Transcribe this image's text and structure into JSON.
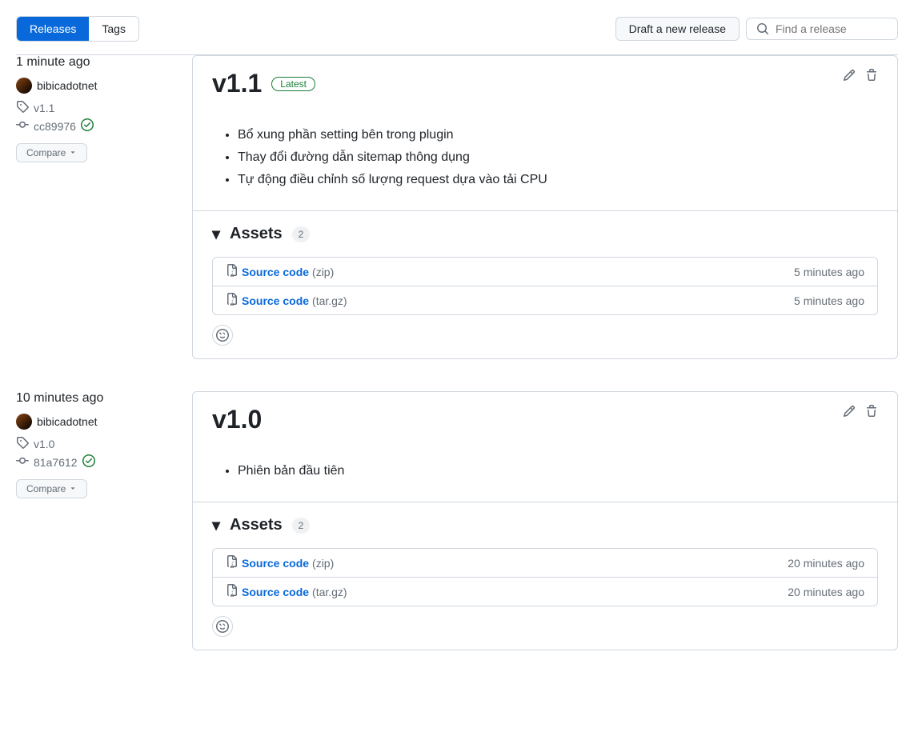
{
  "header": {
    "tabs": {
      "releases": "Releases",
      "tags": "Tags"
    },
    "draft_button": "Draft a new release",
    "search_placeholder": "Find a release"
  },
  "releases": [
    {
      "time": "1 minute ago",
      "author": "bibicadotnet",
      "tag": "v1.1",
      "commit": "cc89976",
      "compare": "Compare",
      "title": "v1.1",
      "latest_label": "Latest",
      "latest": true,
      "notes": [
        "Bổ xung phần setting bên trong plugin",
        "Thay đổi đường dẫn sitemap thông dụng",
        "Tự động điều chỉnh số lượng request dựa vào tải CPU"
      ],
      "assets_label": "Assets",
      "assets_count": "2",
      "assets": [
        {
          "name": "Source code",
          "ext": "(zip)",
          "time": "5 minutes ago"
        },
        {
          "name": "Source code",
          "ext": "(tar.gz)",
          "time": "5 minutes ago"
        }
      ]
    },
    {
      "time": "10 minutes ago",
      "author": "bibicadotnet",
      "tag": "v1.0",
      "commit": "81a7612",
      "compare": "Compare",
      "title": "v1.0",
      "latest": false,
      "notes": [
        "Phiên bản đầu tiên"
      ],
      "assets_label": "Assets",
      "assets_count": "2",
      "assets": [
        {
          "name": "Source code",
          "ext": "(zip)",
          "time": "20 minutes ago"
        },
        {
          "name": "Source code",
          "ext": "(tar.gz)",
          "time": "20 minutes ago"
        }
      ]
    }
  ]
}
